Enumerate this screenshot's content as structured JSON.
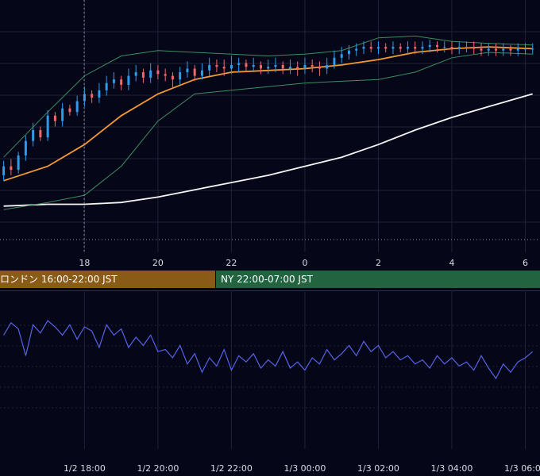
{
  "chart_data": [
    {
      "type": "candlestick",
      "description_scope": "main price panel with Bollinger bands, 20-period and 200-period moving averages",
      "x_tick_labels": [
        "18",
        "20",
        "22",
        "0",
        "2",
        "4",
        "6"
      ],
      "x_range_hours": [
        15.7,
        30.4
      ],
      "y_range": [
        0,
        100
      ],
      "grid": true,
      "legend": "none",
      "series": [
        {
          "kind": "ohlc",
          "hours": [
            15.8,
            16.0,
            16.2,
            16.4,
            16.6,
            16.8,
            17.0,
            17.2,
            17.4,
            17.6,
            17.8,
            18.0,
            18.2,
            18.4,
            18.6,
            18.8,
            19.0,
            19.2,
            19.4,
            19.6,
            19.8,
            20.0,
            20.2,
            20.4,
            20.6,
            20.8,
            21.0,
            21.2,
            21.4,
            21.6,
            21.8,
            22.0,
            22.2,
            22.4,
            22.6,
            22.8,
            23.0,
            23.2,
            23.4,
            23.6,
            23.8,
            24.0,
            24.2,
            24.4,
            24.6,
            24.8,
            25.0,
            25.2,
            25.4,
            25.6,
            25.8,
            26.0,
            26.2,
            26.4,
            26.6,
            26.8,
            27.0,
            27.2,
            27.4,
            27.6,
            27.8,
            28.0,
            28.2,
            28.4,
            28.6,
            28.8,
            29.0,
            29.2,
            29.4,
            29.6,
            29.8,
            30.0,
            30.2
          ],
          "open": [
            25,
            30,
            28,
            36,
            44,
            50,
            46,
            58,
            55,
            62,
            60,
            66,
            70,
            68,
            72,
            76,
            78,
            75,
            80,
            82,
            79,
            83,
            81,
            80,
            78,
            82,
            84,
            80,
            83,
            86,
            85,
            84,
            86,
            87,
            85,
            86,
            84,
            85,
            86,
            84,
            85,
            84,
            86,
            85,
            84,
            86,
            90,
            92,
            94,
            95,
            96,
            95,
            96,
            95,
            96,
            95,
            96,
            95,
            96,
            97,
            96,
            96,
            95,
            96,
            96,
            95,
            94,
            95,
            94,
            95,
            94,
            95,
            95
          ],
          "close": [
            30,
            28,
            36,
            44,
            50,
            46,
            58,
            55,
            62,
            60,
            66,
            70,
            68,
            72,
            76,
            78,
            75,
            80,
            82,
            79,
            83,
            81,
            80,
            78,
            82,
            84,
            80,
            83,
            86,
            85,
            84,
            86,
            87,
            85,
            86,
            84,
            85,
            86,
            84,
            85,
            84,
            86,
            85,
            84,
            86,
            90,
            92,
            94,
            95,
            96,
            95,
            96,
            95,
            96,
            95,
            96,
            95,
            96,
            97,
            96,
            96,
            95,
            96,
            96,
            95,
            94,
            95,
            94,
            95,
            94,
            95,
            95,
            95
          ],
          "high": [
            33,
            34,
            38,
            47,
            54,
            52,
            61,
            60,
            65,
            64,
            69,
            74,
            72,
            76,
            80,
            82,
            80,
            84,
            86,
            84,
            87,
            86,
            84,
            82,
            85,
            88,
            86,
            87,
            90,
            89,
            89,
            91,
            90,
            89,
            90,
            88,
            89,
            90,
            88,
            89,
            88,
            90,
            89,
            88,
            90,
            94,
            96,
            97,
            98,
            99,
            99,
            99,
            98,
            99,
            98,
            99,
            99,
            99,
            100,
            99,
            99,
            99,
            99,
            99,
            99,
            98,
            98,
            98,
            98,
            97,
            98,
            98,
            98
          ],
          "low": [
            22,
            25,
            26,
            33,
            41,
            44,
            44,
            52,
            52,
            58,
            58,
            63,
            65,
            65,
            69,
            73,
            72,
            72,
            77,
            76,
            76,
            78,
            77,
            73,
            75,
            79,
            77,
            78,
            80,
            82,
            80,
            81,
            82,
            82,
            82,
            81,
            81,
            82,
            81,
            81,
            80,
            81,
            82,
            80,
            81,
            84,
            87,
            89,
            91,
            92,
            93,
            92,
            93,
            92,
            93,
            92,
            92,
            92,
            93,
            93,
            93,
            92,
            92,
            93,
            92,
            91,
            91,
            91,
            91,
            91,
            91,
            92,
            92
          ]
        },
        {
          "kind": "line",
          "color": "#f39a32",
          "hours": [
            15.8,
            17.0,
            18.0,
            19.0,
            20.0,
            21.0,
            22.0,
            23.0,
            24.0,
            25.0,
            26.0,
            27.0,
            28.0,
            29.0,
            30.2
          ],
          "values": [
            22,
            30,
            42,
            58,
            70,
            78,
            82,
            83,
            84,
            86,
            89,
            93,
            95,
            96,
            95
          ]
        },
        {
          "kind": "line",
          "color": "#f5f5f5",
          "hours": [
            15.8,
            17.0,
            18.0,
            19.0,
            20.0,
            21.0,
            22.0,
            23.0,
            24.0,
            25.0,
            26.0,
            27.0,
            28.0,
            29.0,
            30.2
          ],
          "values": [
            8,
            9,
            9,
            10,
            13,
            17,
            21,
            25,
            30,
            35,
            42,
            50,
            57,
            63,
            70
          ]
        },
        {
          "kind": "line",
          "color": "#3b8f5f",
          "hours": [
            15.8,
            17.0,
            18.0,
            19.0,
            20.0,
            21.0,
            22.0,
            23.0,
            24.0,
            25.0,
            26.0,
            27.0,
            28.0,
            29.0,
            30.2
          ],
          "values": [
            35,
            60,
            80,
            91,
            94,
            93,
            92,
            91,
            92,
            94,
            101,
            102,
            99,
            98,
            97
          ]
        },
        {
          "kind": "line",
          "color": "#3b8f5f",
          "hours": [
            15.8,
            17.0,
            18.0,
            19.0,
            20.0,
            21.0,
            22.0,
            23.0,
            24.0,
            25.0,
            26.0,
            27.0,
            28.0,
            29.0,
            30.2
          ],
          "values": [
            6,
            10,
            14,
            30,
            55,
            70,
            72,
            74,
            76,
            77,
            78,
            82,
            90,
            93,
            92
          ]
        }
      ]
    },
    {
      "type": "line",
      "description_scope": "oscillator sub panel",
      "x_tick_labels": [
        "1/2 18:00",
        "1/2 20:00",
        "1/2 22:00",
        "1/3 00:00",
        "1/3 02:00",
        "1/3 04:00",
        "1/3 06:00"
      ],
      "x_range_hours": [
        15.7,
        30.4
      ],
      "y_range": [
        0,
        100
      ],
      "grid": true,
      "legend": "none",
      "series": [
        {
          "color": "#5564e6",
          "hours": [
            15.8,
            16.0,
            16.2,
            16.4,
            16.6,
            16.8,
            17.0,
            17.2,
            17.4,
            17.6,
            17.8,
            18.0,
            18.2,
            18.4,
            18.6,
            18.8,
            19.0,
            19.2,
            19.4,
            19.6,
            19.8,
            20.0,
            20.2,
            20.4,
            20.6,
            20.8,
            21.0,
            21.2,
            21.4,
            21.6,
            21.8,
            22.0,
            22.2,
            22.4,
            22.6,
            22.8,
            23.0,
            23.2,
            23.4,
            23.6,
            23.8,
            24.0,
            24.2,
            24.4,
            24.6,
            24.8,
            25.0,
            25.2,
            25.4,
            25.6,
            25.8,
            26.0,
            26.2,
            26.4,
            26.6,
            26.8,
            27.0,
            27.2,
            27.4,
            27.6,
            27.8,
            28.0,
            28.2,
            28.4,
            28.6,
            28.8,
            29.0,
            29.2,
            29.4,
            29.6,
            29.8,
            30.0,
            30.2
          ],
          "values": [
            72,
            84,
            78,
            52,
            82,
            74,
            86,
            80,
            72,
            82,
            68,
            80,
            76,
            60,
            82,
            72,
            78,
            60,
            70,
            62,
            72,
            56,
            58,
            50,
            62,
            44,
            54,
            36,
            50,
            42,
            58,
            38,
            52,
            46,
            54,
            40,
            48,
            42,
            56,
            40,
            46,
            38,
            50,
            44,
            58,
            48,
            54,
            62,
            52,
            66,
            56,
            62,
            50,
            56,
            48,
            52,
            44,
            48,
            40,
            52,
            44,
            50,
            42,
            46,
            38,
            52,
            40,
            30,
            44,
            36,
            46,
            50,
            56
          ]
        }
      ]
    }
  ],
  "sessions": {
    "london_label": "ロンドン 16:00-22:00 JST",
    "ny_label": "NY 22:00-07:00 JST"
  },
  "colors": {
    "background": "#060619",
    "grid": "#1e2238",
    "bull": "#2f9bea",
    "bear": "#f0686a",
    "axis_text": "#d8dbe6"
  }
}
